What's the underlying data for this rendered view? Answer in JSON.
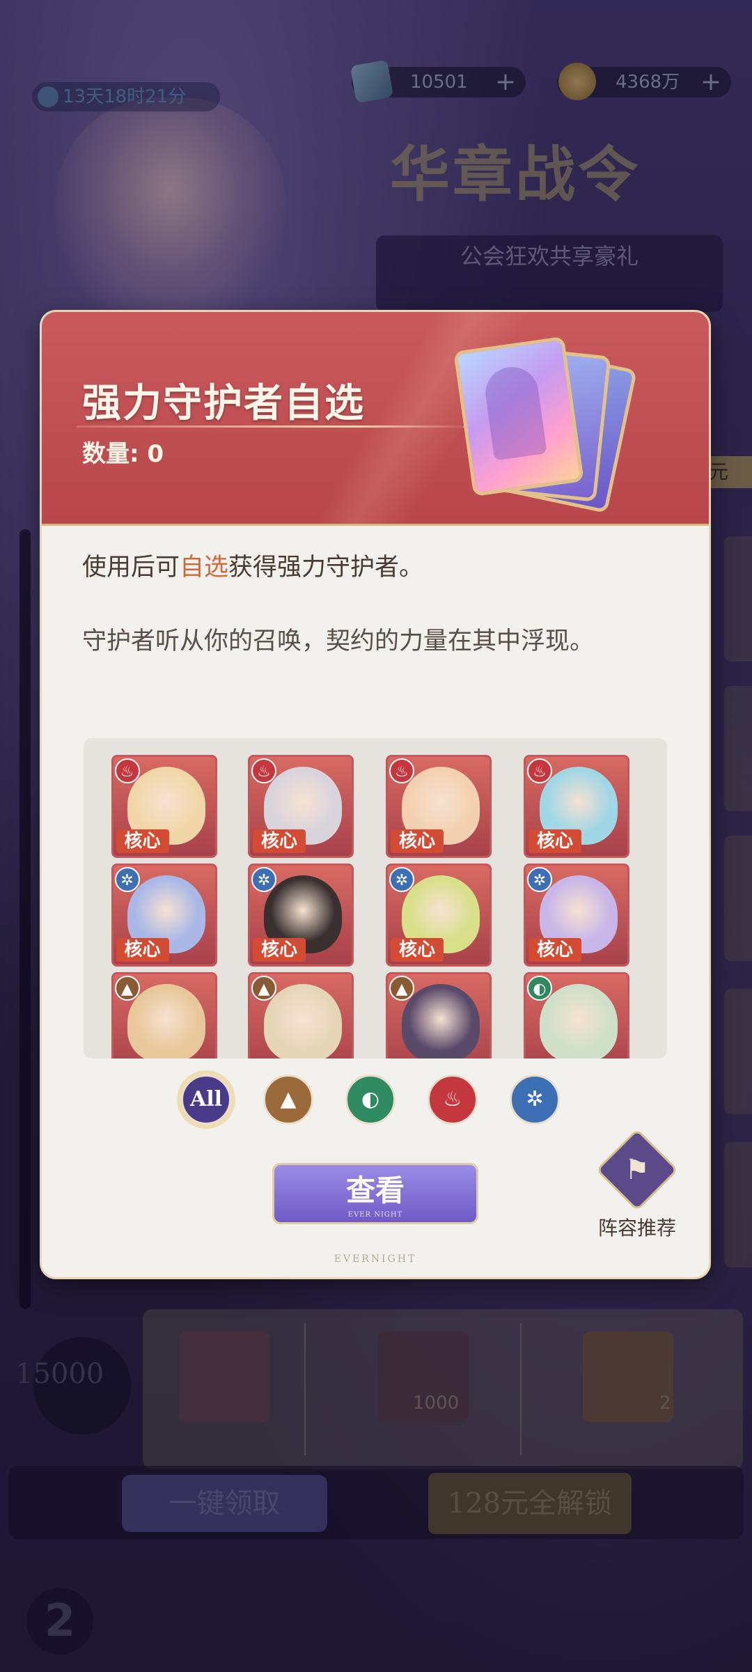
{
  "background": {
    "timer": "13天18时21分",
    "currency_1": {
      "icon": "ticket-icon",
      "value": "10501",
      "plus": "+"
    },
    "currency_2": {
      "icon": "gold-coin-icon",
      "value": "4368万",
      "plus": "+"
    },
    "battle_pass_title": "华章战令",
    "guild_banner": "公会狂欢共享豪礼",
    "side_badge": "元",
    "progress_value": "15000",
    "reward_amount_1": "1000",
    "reward_amount_2": "2",
    "claim_all_label": "一键领取",
    "unlock_label": "128元全解锁"
  },
  "modal": {
    "title": "强力守护者自选",
    "quantity": "数量: 0",
    "description_prefix": "使用后可",
    "description_highlight": "自选",
    "description_suffix": "获得强力守护者。",
    "flavor_text": "守护者听从你的召唤，契约的力量在其中浮现。",
    "core_label": "核心",
    "heroes": [
      {
        "element": "fire",
        "core": true
      },
      {
        "element": "fire",
        "core": true
      },
      {
        "element": "fire",
        "core": true
      },
      {
        "element": "fire",
        "core": true
      },
      {
        "element": "ice",
        "core": true
      },
      {
        "element": "ice",
        "core": true
      },
      {
        "element": "ice",
        "core": true
      },
      {
        "element": "ice",
        "core": true
      },
      {
        "element": "earth",
        "core": false
      },
      {
        "element": "earth",
        "core": false
      },
      {
        "element": "earth",
        "core": false
      },
      {
        "element": "wind",
        "core": false
      }
    ],
    "filters": [
      {
        "id": "all",
        "label": "All",
        "selected": true
      },
      {
        "id": "earth",
        "icon": "mountain-icon",
        "selected": false
      },
      {
        "id": "wind",
        "icon": "wind-icon",
        "selected": false
      },
      {
        "id": "fire",
        "icon": "flame-icon",
        "selected": false
      },
      {
        "id": "ice",
        "icon": "snowflake-icon",
        "selected": false
      }
    ],
    "view_button": "查看",
    "view_button_sub": "EVER NIGHT",
    "recommend_label": "阵容推荐",
    "brand": "EVERNIGHT"
  },
  "colors": {
    "header_red": "#b8464a",
    "highlight": "#cf6a3a",
    "button_purple": "#6f5bc6",
    "gold_trim": "#e7d6b2"
  }
}
